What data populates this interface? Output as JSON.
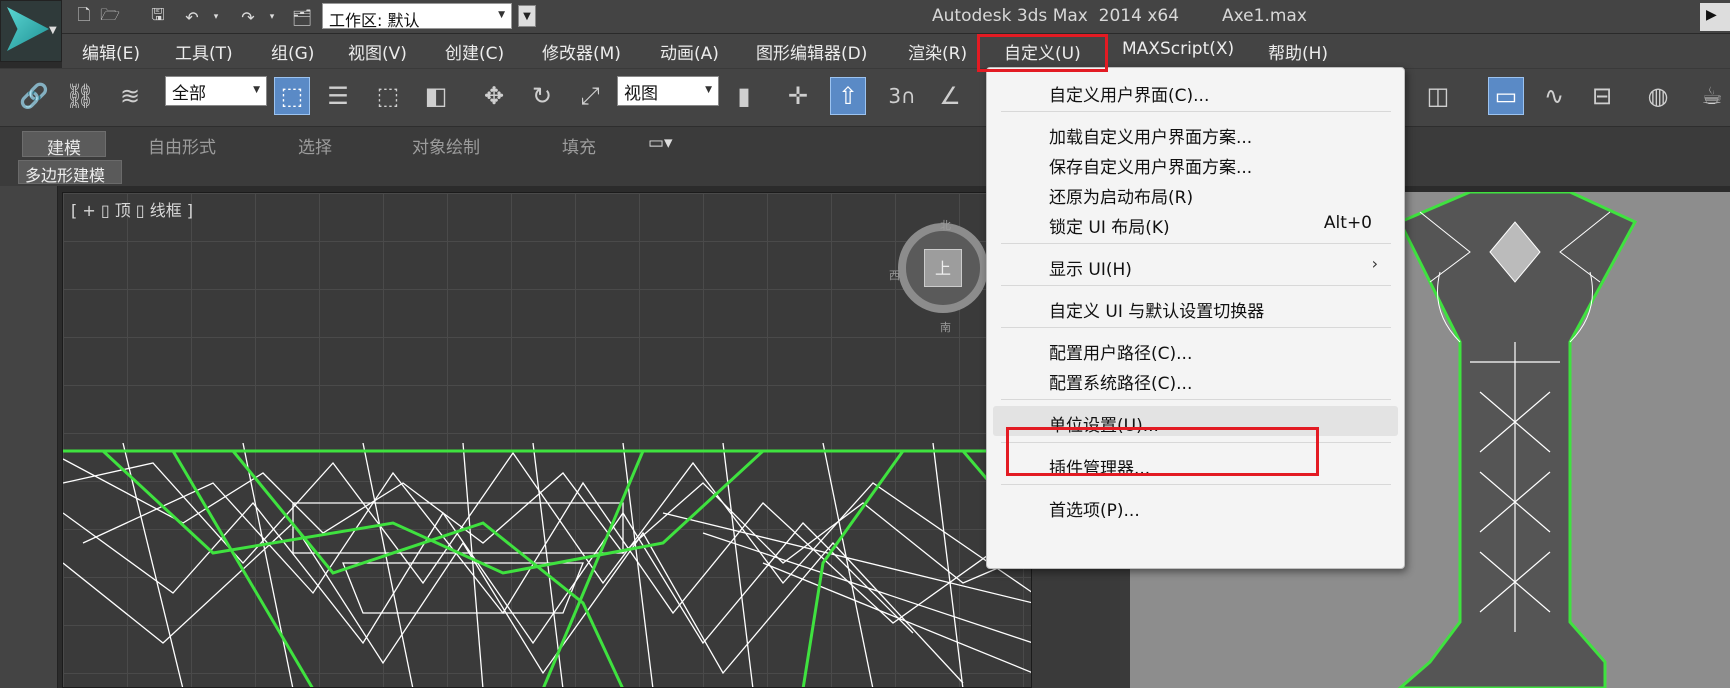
{
  "titlebar": {
    "app_title": "Autodesk 3ds Max  2014 x64",
    "file_name": "Axe1.max",
    "workspace_value": "工作区: 默认",
    "right_glyph": "▶ 🗋"
  },
  "menubar": {
    "items": [
      "编辑(E)",
      "工具(T)",
      "组(G)",
      "视图(V)",
      "创建(C)",
      "修改器(M)",
      "动画(A)",
      "图形编辑器(D)",
      "渲染(R)",
      "自定义(U)",
      "MAXScript(X)",
      "帮助(H)"
    ],
    "active_item": "自定义(U)"
  },
  "toolbar": {
    "selection_filter": "全部",
    "reference_coord": "视图",
    "snap_label": "3"
  },
  "ribbon": {
    "tabs": [
      "建模",
      "自由形式",
      "选择",
      "对象绘制",
      "填充"
    ],
    "selected_tab": "建模",
    "panel_label": "多边形建模"
  },
  "viewport": {
    "label": "[ + ▯ 顶 ▯ 线框 ]",
    "viewcube_face": "上",
    "viewcube_north": "北",
    "viewcube_south": "南",
    "viewcube_west": "西"
  },
  "dropdown": {
    "items": [
      {
        "label": "自定义用户界面(C)...",
        "shortcut": ""
      },
      {
        "label": "加载自定义用户界面方案...",
        "shortcut": ""
      },
      {
        "label": "保存自定义用户界面方案...",
        "shortcut": ""
      },
      {
        "label": "还原为启动布局(R)",
        "shortcut": ""
      },
      {
        "label": "锁定 UI 布局(K)",
        "shortcut": "Alt+0"
      },
      {
        "label": "显示 UI(H)",
        "shortcut": "›"
      },
      {
        "label": "自定义 UI 与默认设置切换器",
        "shortcut": ""
      },
      {
        "label": "配置用户路径(C)...",
        "shortcut": ""
      },
      {
        "label": "配置系统路径(C)...",
        "shortcut": ""
      },
      {
        "label": "单位设置(U)...",
        "shortcut": ""
      },
      {
        "label": "插件管理器...",
        "shortcut": ""
      },
      {
        "label": "首选项(P)...",
        "shortcut": ""
      }
    ],
    "highlighted_item": "单位设置(U)..."
  },
  "colors": {
    "highlight_box": "#e31b23",
    "wireframe_green": "#3fe23f",
    "wireframe_white": "#ffffff",
    "ribbon_tab_selected": "#5b5b5b"
  }
}
